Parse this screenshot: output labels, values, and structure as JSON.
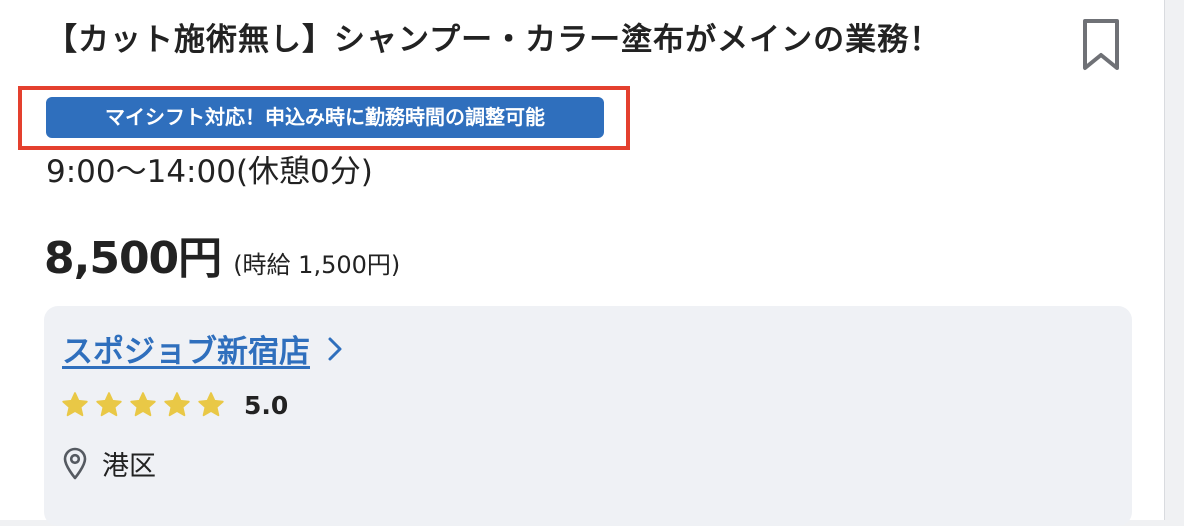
{
  "job": {
    "title": "【カット施術無し】シャンプー・カラー塗布がメインの業務！",
    "badge": "マイシフト対応！申込み時に勤務時間の調整可能",
    "time": "9:00〜14:00(休憩0分)",
    "wage_main": "8,500円",
    "wage_sub": "(時給 1,500円)"
  },
  "store": {
    "name": "スポジョブ新宿店",
    "rating": 5.0,
    "rating_label": "5.0",
    "location": "港区"
  },
  "icons": {
    "bookmark": "bookmark-icon",
    "chevron": "chevron-right-icon",
    "star": "star-icon",
    "pin": "location-pin-icon"
  },
  "colors": {
    "accent_blue": "#2f6fbd",
    "highlight_red": "#e4402e",
    "star_yellow": "#e9c846",
    "text": "#222222",
    "store_bg": "#eff1f5"
  }
}
